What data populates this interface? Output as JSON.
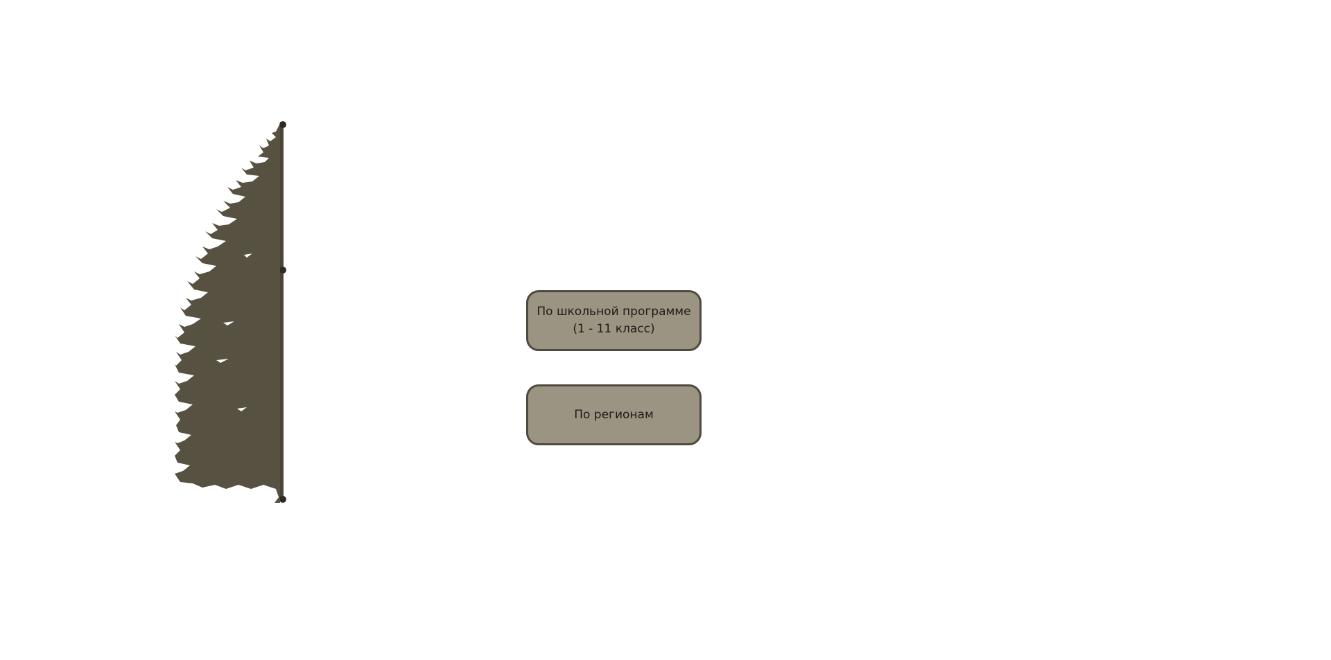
{
  "colors": {
    "tree": "#575141",
    "pole": "#4a4536",
    "button_bg": "#9c9482",
    "button_border": "#4f4a3e",
    "button_text": "#1f1c16"
  },
  "menu": {
    "school_program": {
      "label": "По школьной программе\n(1 - 11 класс)"
    },
    "regions": {
      "label": "По регионам"
    }
  },
  "decoration": {
    "icon": "fir-tree-icon"
  }
}
